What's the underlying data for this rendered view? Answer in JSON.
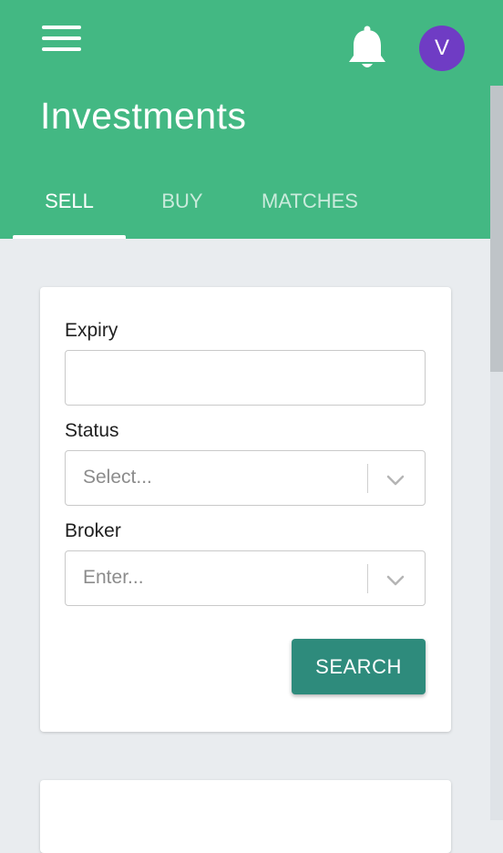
{
  "header": {
    "title": "Investments",
    "avatar_initial": "V",
    "menu_icon": "hamburger-menu-icon",
    "notification_icon": "bell-icon",
    "colors": {
      "appbar": "#43b883",
      "avatar": "#6f3cc4",
      "primary_button": "#2e8b7c",
      "background": "#e9ecef"
    }
  },
  "tabs": [
    {
      "label": "SELL",
      "active": true
    },
    {
      "label": "BUY",
      "active": false
    },
    {
      "label": "MATCHES",
      "active": false
    }
  ],
  "filters": {
    "expiry": {
      "label": "Expiry",
      "value": ""
    },
    "status": {
      "label": "Status",
      "placeholder": "Select...",
      "icon": "chevron-down-icon"
    },
    "broker": {
      "label": "Broker",
      "placeholder": "Enter...",
      "icon": "chevron-down-icon"
    },
    "search_label": "SEARCH"
  }
}
